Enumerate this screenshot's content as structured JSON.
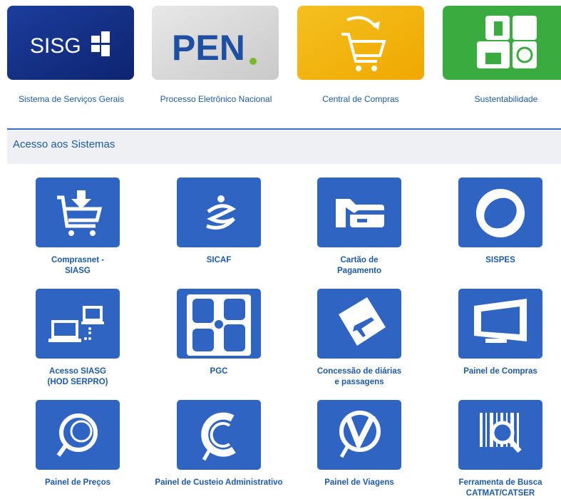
{
  "banners": {
    "sisg": {
      "logo_text": "SISG",
      "label": "Sistema de Serviços Gerais"
    },
    "pen": {
      "logo_text": "PEN",
      "label": "Processo Eletrônico Nacional"
    },
    "compras": {
      "label": "Central de Compras"
    },
    "sustentabilidade": {
      "label": "Sustentabilidade"
    }
  },
  "section": {
    "title": "Acesso aos Sistemas"
  },
  "systems": {
    "comprasnet": "Comprasnet -\nSIASG",
    "sicaf": "SICAF",
    "cartao": "Cartão de\nPagamento",
    "sispes": "SISPES",
    "siasg_hod": "Acesso SIASG\n(HOD SERPRO)",
    "pgc": "PGC",
    "diarias": "Concessão de diárias\ne passagens",
    "painel_compras": "Painel de Compras",
    "painel_precos": "Painel de Preços",
    "painel_custeio": "Painel de Custeio Administrativo",
    "painel_viagens": "Painel de Viagens",
    "catmat": "Ferramenta de Busca\nCATMAT/CATSER"
  },
  "colors": {
    "tile": "#2f64c2",
    "label": "#1e5aa6",
    "section_border": "#3a6fc0"
  }
}
